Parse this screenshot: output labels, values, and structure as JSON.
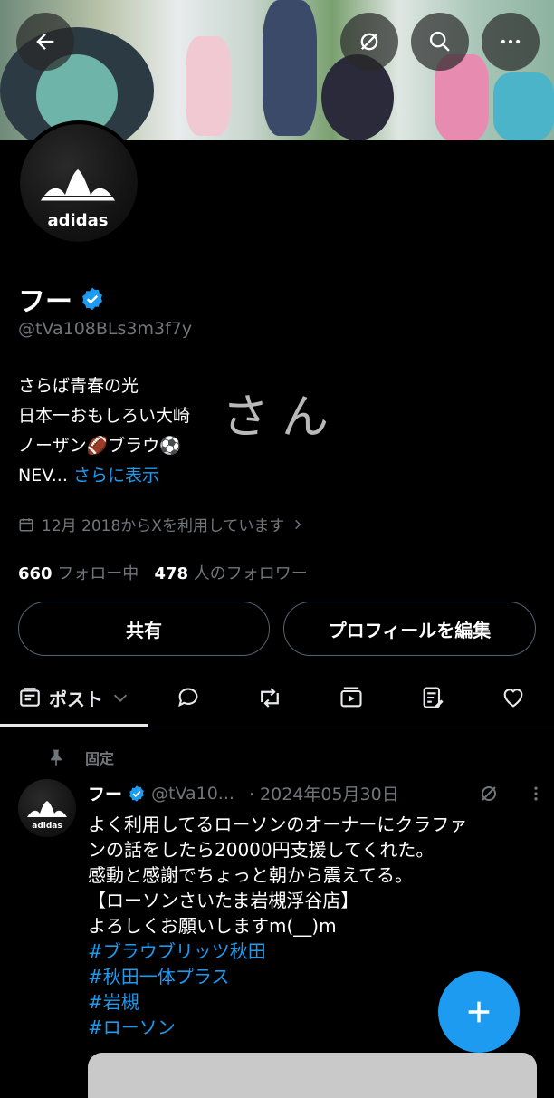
{
  "profile": {
    "display_name": "フー",
    "handle": "@tVa108BLs3m3f7y",
    "bio_lines": [
      "さらば青春の光",
      "日本一おもしろい大崎",
      "ノーザン🏈ブラウ⚽",
      "NEV..."
    ],
    "bio_more": "さらに表示",
    "handwriting": "さん",
    "joined": "12月 2018からXを利用しています",
    "following_count": "660",
    "following_label": "フォロー中",
    "followers_count": "478",
    "followers_label": "人のフォロワー",
    "share_label": "共有",
    "edit_label": "プロフィールを編集",
    "avatar_text": "adidas"
  },
  "tabs": {
    "posts_label": "ポスト"
  },
  "post": {
    "pinned_label": "固定",
    "name": "フー",
    "handle": "@tVa10...",
    "date": "· 2024年05月30日",
    "avatar_text": "adidas",
    "lines": [
      "よく利用してるローソンのオーナーにクラファ",
      "ンの話をしたら20000円支援してくれた。",
      "感動と感謝でちょっと朝から震えてる。",
      "【ローソンさいたま岩槻浮谷店】",
      "よろしくお願いしますm(__)m"
    ],
    "hashtags": [
      "#ブラウブリッツ秋田",
      "#秋田一体プラス",
      "#岩槻",
      "#ローソン"
    ]
  },
  "colors": {
    "accent": "#1d9bf0",
    "background": "#000000",
    "muted": "#71767b"
  }
}
